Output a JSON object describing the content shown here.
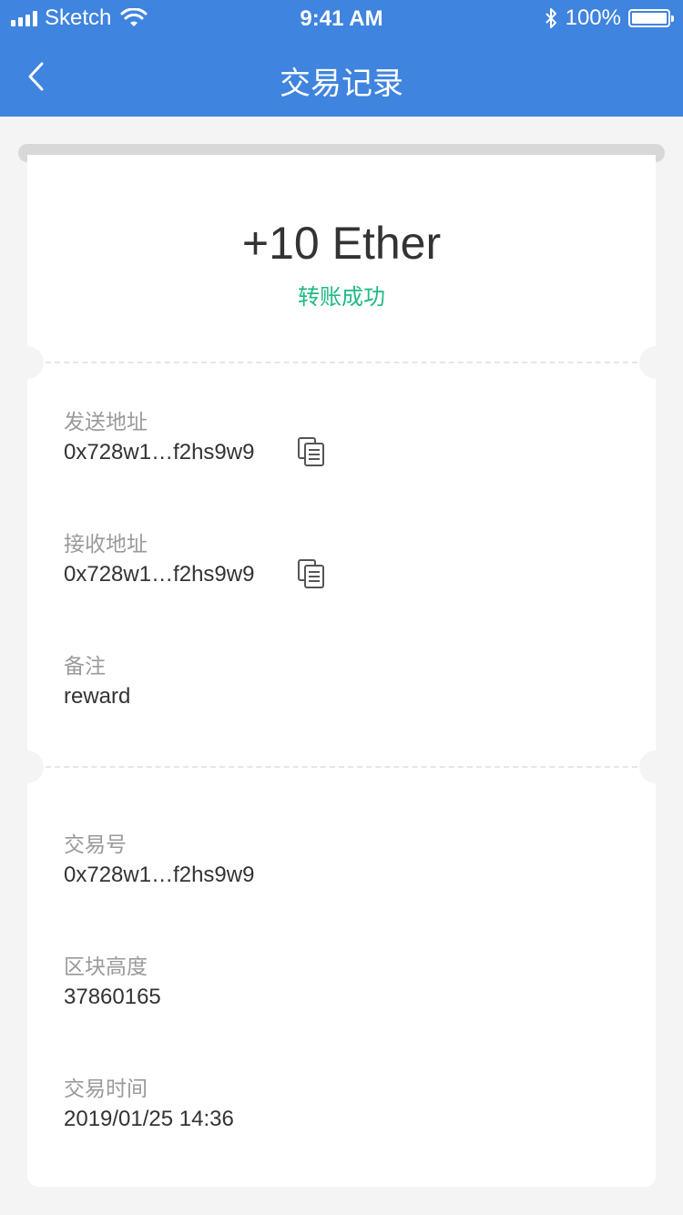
{
  "status_bar": {
    "carrier": "Sketch",
    "time": "9:41 AM",
    "battery_percent": "100%",
    "battery_level": 1.0,
    "signal_icon": "signal-bars-icon",
    "wifi_icon": "wifi-icon",
    "bluetooth_icon": "bluetooth-icon"
  },
  "nav": {
    "title": "交易记录",
    "back_icon": "chevron-left-icon"
  },
  "summary": {
    "amount": "+10 Ether",
    "status": "转账成功",
    "status_color": "#1fb985"
  },
  "details": {
    "from_label": "发送地址",
    "from_value": "0x728w1…f2hs9w9",
    "to_label": "接收地址",
    "to_value": "0x728w1…f2hs9w9",
    "memo_label": "备注",
    "memo_value": "reward",
    "copy_icon": "copy-icon"
  },
  "chain": {
    "txid_label": "交易号",
    "txid_value": "0x728w1…f2hs9w9",
    "block_label": "区块高度",
    "block_value": "37860165",
    "time_label": "交易时间",
    "time_value": "2019/01/25 14:36"
  },
  "colors": {
    "header": "#3f84de",
    "background": "#f4f4f4",
    "label": "#9a9a9a",
    "text": "#333333"
  }
}
